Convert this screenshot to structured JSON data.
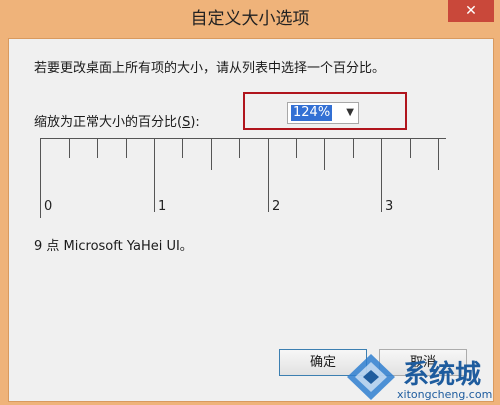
{
  "window": {
    "title": "自定义大小选项",
    "close_glyph": "✕"
  },
  "instruction": "若要更改桌面上所有项的大小，请从列表中选择一个百分比。",
  "scale": {
    "label_prefix": "缩放为正常大小的百分比(",
    "label_mnemonic": "S",
    "label_suffix": "):",
    "selected_value": "124%"
  },
  "ruler": {
    "labels": [
      "0",
      "1",
      "2",
      "3"
    ]
  },
  "font_info": "9 点 Microsoft YaHei UI。",
  "buttons": {
    "ok": "确定",
    "cancel": "取消"
  },
  "watermark": {
    "brand": "系统城",
    "url": "xitongcheng.com"
  },
  "colors": {
    "title_bar": "#efb37a",
    "highlight_box": "#b0141c",
    "selection": "#3370d4"
  }
}
